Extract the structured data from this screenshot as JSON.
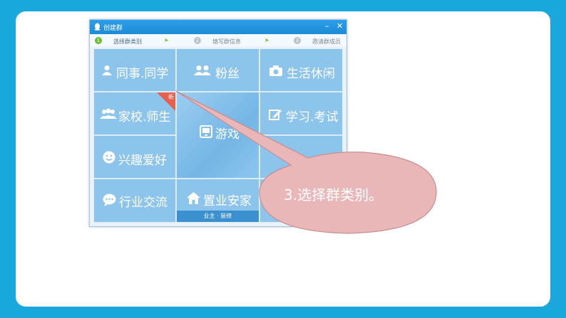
{
  "window": {
    "title": "创建群",
    "minimize_glyph": "–",
    "close_glyph": "✕"
  },
  "steps": [
    {
      "num": "1",
      "label": "选择群类别"
    },
    {
      "num": "2",
      "label": "填写群信息"
    },
    {
      "num": "3",
      "label": "邀请群成员"
    }
  ],
  "step_arrow": "➤",
  "categories": {
    "colleagues": {
      "label": "同事.同学",
      "icon": "person-icon"
    },
    "fans": {
      "label": "粉丝",
      "icon": "people-icon"
    },
    "life": {
      "label": "生活休闲",
      "icon": "camera-icon"
    },
    "school": {
      "label": "家校.师生",
      "icon": "group-icon",
      "badge": "新"
    },
    "game": {
      "label": "游戏",
      "icon": "gamepad-icon"
    },
    "study": {
      "label": "学习.考试",
      "icon": "pencil-icon"
    },
    "interest": {
      "label": "兴趣爱好",
      "icon": "smile-icon"
    },
    "industry": {
      "label": "行业交流",
      "icon": "chat-icon"
    },
    "home": {
      "label": "置业安家",
      "icon": "house-icon",
      "sub": "业主 · 装修"
    }
  },
  "callout": {
    "text": "3.选择群类别。",
    "fill": "#eab7b8",
    "stroke": "#c98c8e"
  },
  "colors": {
    "background": "#1aa8dc",
    "tile": "#8dc4ec",
    "titlebar": "#1d8bd8",
    "step_active": "#6cbf2f"
  }
}
